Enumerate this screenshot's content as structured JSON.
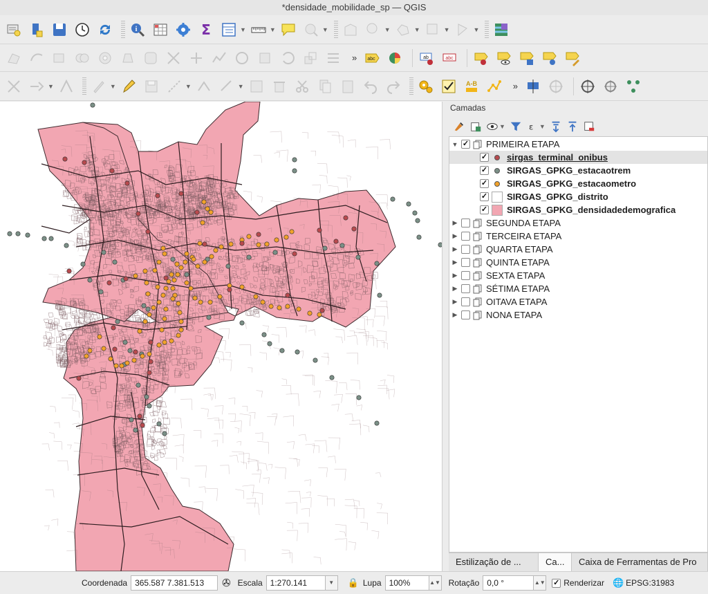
{
  "window": {
    "title": "*densidade_mobilidade_sp — QGIS"
  },
  "toolbar": {
    "row1": [
      "new-project-icon",
      "open-project-icon",
      "save-project-icon",
      "clock-icon",
      "refresh-icon",
      "identify-icon",
      "field-calculator-icon",
      "gear-star-icon",
      "statistics-sum-icon",
      "attribute-table-icon",
      "measure-icon",
      "map-tips-icon",
      "select-features-icon",
      "select-by-expression-icon",
      "move-label-icon",
      "rotate-icon",
      "deselect-icon",
      "python-icon"
    ],
    "row3_more": "»",
    "row2_more": "»"
  },
  "panel": {
    "title": "Camadas",
    "tools": [
      "style-manager-icon",
      "add-group-icon",
      "visibility-icon",
      "filter-legend-icon",
      "expression-filter-icon",
      "expand-all-icon",
      "collapse-all-icon",
      "remove-layer-icon"
    ]
  },
  "layers": {
    "group1": "PRIMEIRA ETAPA",
    "items": [
      {
        "name": "sirgas_terminal_onibus",
        "color": "#b84a4e",
        "type": "point",
        "checked": "✓"
      },
      {
        "name": "SIRGAS_GPKG_estacaotrem",
        "color": "#7b9087",
        "type": "point",
        "checked": "✓"
      },
      {
        "name": "SIRGAS_GPKG_estacaometro",
        "color": "#f2a22a",
        "type": "point",
        "checked": "✓"
      },
      {
        "name": "SIRGAS_GPKG_distrito",
        "color": "#ffffff",
        "type": "polygon",
        "checked": "✓"
      },
      {
        "name": "SIRGAS_GPKG_densidadedemografica",
        "color": "#f2a6b2",
        "type": "polygon",
        "checked": "✓"
      }
    ],
    "groups": [
      "SEGUNDA ETAPA",
      "TERCEIRA ETAPA",
      "QUARTA ETAPA",
      "QUINTA ETAPA",
      "SEXTA ETAPA",
      "SÉTIMA ETAPA",
      "OITAVA ETAPA",
      "NONA ETAPA"
    ]
  },
  "tabs": [
    "Estilização de ...",
    "Ca...",
    "Caixa de Ferramentas de Pro"
  ],
  "status": {
    "coord_label": "Coordenada",
    "coord_value": "365.587  7.381.513",
    "scale_label": "Escala",
    "scale_value": "1:270.141",
    "magnifier_label": "Lupa",
    "magnifier_value": "100%",
    "rotation_label": "Rotação",
    "rotation_value": "0,0 °",
    "render_label": "Renderizar",
    "render_checked": "✓",
    "crs": "EPSG:31983"
  },
  "map": {
    "fill": "#f2a6b2",
    "outline": "#3d2a2e",
    "train": "#7b9087",
    "metro": "#f2a22a",
    "bus": "#b84a4e"
  }
}
